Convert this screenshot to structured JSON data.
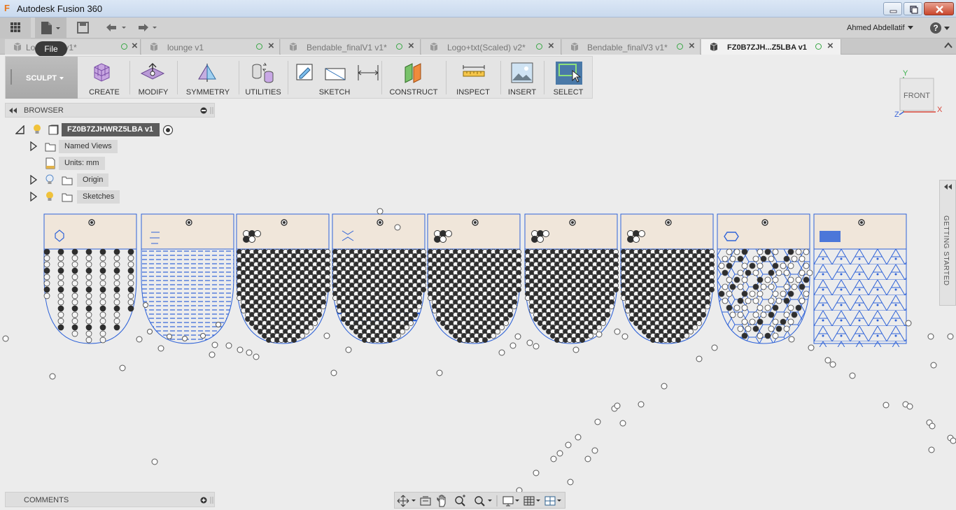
{
  "app": {
    "title": "Autodesk Fusion 360"
  },
  "user": {
    "name": "Ahmed Abdellatif"
  },
  "tooltip": {
    "file": "File"
  },
  "tabs": [
    {
      "label": "Lo    r...final v1*",
      "active": false
    },
    {
      "label": "lounge v1",
      "active": false
    },
    {
      "label": "Bendable_finalV1 v1*",
      "active": false
    },
    {
      "label": "Logo+txt(Scaled) v2*",
      "active": false
    },
    {
      "label": "Bendable_finalV3 v1*",
      "active": false
    },
    {
      "label": "FZ0B7ZJH...Z5LBA v1",
      "active": true
    }
  ],
  "ribbon": {
    "workspace": "SCULPT",
    "groups": [
      "CREATE",
      "MODIFY",
      "SYMMETRY",
      "UTILITIES",
      "SKETCH",
      "CONSTRUCT",
      "INSPECT",
      "INSERT",
      "SELECT"
    ]
  },
  "browser": {
    "title": "BROWSER",
    "root": "FZ0B7ZJHWRZ5LBA v1",
    "items": [
      {
        "label": "Named Views"
      },
      {
        "label": "Units: mm"
      },
      {
        "label": "Origin"
      },
      {
        "label": "Sketches"
      }
    ]
  },
  "viewcube": {
    "face": "FRONT",
    "axis_y": "Y",
    "axis_x": "X",
    "axis_z": "Z"
  },
  "panels": {
    "getting_started": "GETTING STARTED",
    "comments": "COMMENTS"
  },
  "colors": {
    "sketch_blue": "#2f63d8",
    "cell_fill": "#f0e6da",
    "dark_dot": "#2e2e2e",
    "orange_accent": "#e8761a"
  },
  "icons": [
    "data-panel-grid-icon",
    "file-menu-icon",
    "save-icon",
    "undo-icon",
    "redo-icon",
    "help-icon",
    "close-icon",
    "lightbulb-icon",
    "folder-icon",
    "units-icon",
    "orbit-icon",
    "pan-icon",
    "zoom-icon",
    "display-settings-icon",
    "grid-icon",
    "viewports-icon"
  ]
}
